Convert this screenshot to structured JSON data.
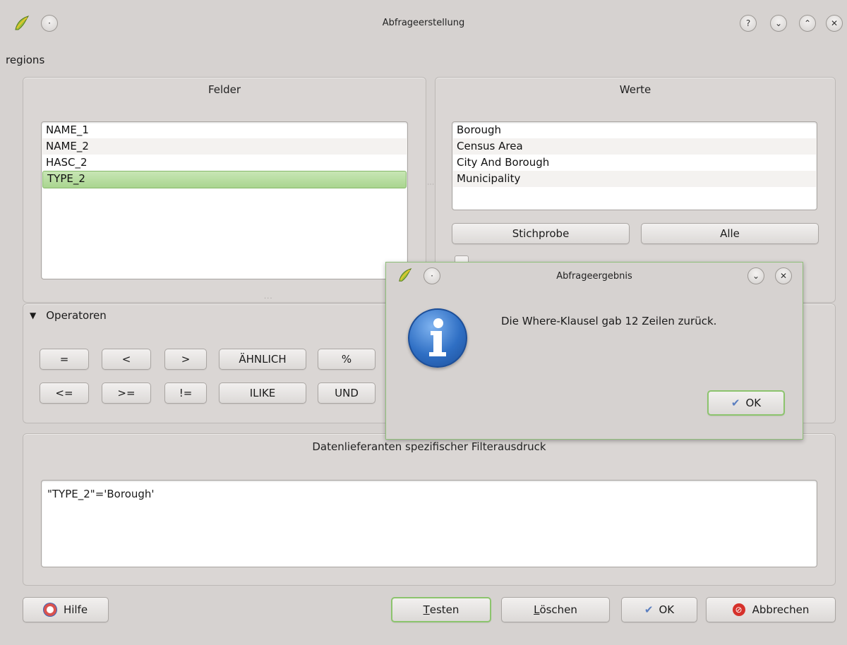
{
  "window": {
    "title": "Abfrageerstellung",
    "layer_name": "regions"
  },
  "fields": {
    "title": "Felder",
    "items": [
      "NAME_1",
      "NAME_2",
      "HASC_2",
      "TYPE_2"
    ],
    "selected": "TYPE_2"
  },
  "values": {
    "title": "Werte",
    "items": [
      "Borough",
      "Census Area",
      "City And Borough",
      "Municipality"
    ],
    "sample_label": "Stichprobe",
    "all_label": "Alle"
  },
  "operators": {
    "title": "Operatoren",
    "row1": [
      "=",
      "<",
      ">",
      "ÄHNLICH",
      "%"
    ],
    "row2": [
      "<=",
      ">=",
      "!=",
      "ILIKE",
      "UND"
    ]
  },
  "filter": {
    "title": "Datenlieferanten spezifischer Filterausdruck",
    "expression": "\"TYPE_2\"='Borough'"
  },
  "buttons": {
    "help": "Hilfe",
    "test_prefix": "T",
    "test_rest": "esten",
    "clear_prefix": "L",
    "clear_rest": "öschen",
    "ok": "OK",
    "cancel": "Abbrechen"
  },
  "result_dialog": {
    "title": "Abfrageergebnis",
    "message": "Die Where-Klausel gab 12 Zeilen zurück.",
    "ok": "OK"
  },
  "colors": {
    "accent_green": "#8cc46d",
    "info_blue": "#2f6fc4"
  }
}
